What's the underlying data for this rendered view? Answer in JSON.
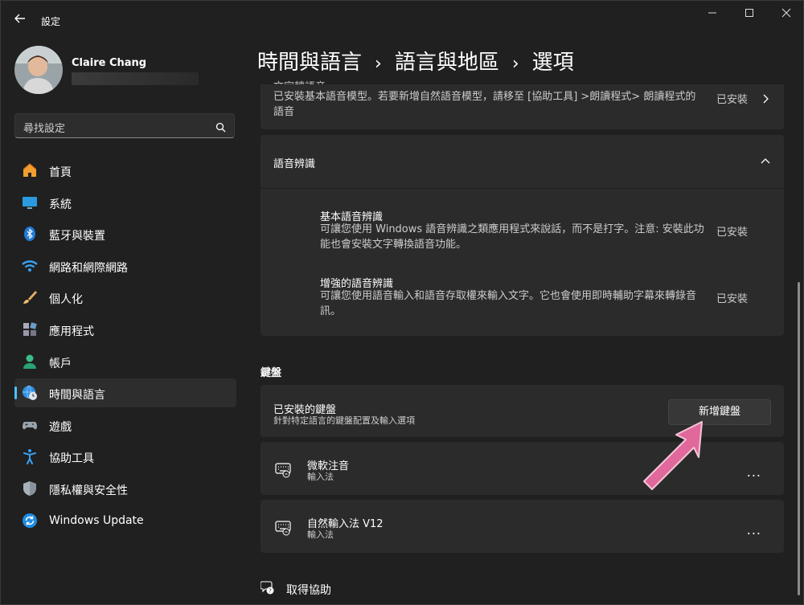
{
  "window": {
    "title": "設定",
    "controls": [
      "minimize",
      "maximize",
      "close"
    ]
  },
  "profile": {
    "name": "Claire Chang"
  },
  "search": {
    "placeholder": "尋找設定"
  },
  "sidebar": {
    "items": [
      {
        "label": "首頁",
        "icon": "home-icon"
      },
      {
        "label": "系統",
        "icon": "system-icon"
      },
      {
        "label": "藍牙與裝置",
        "icon": "bluetooth-icon"
      },
      {
        "label": "網路和網際網路",
        "icon": "wifi-icon"
      },
      {
        "label": "個人化",
        "icon": "brush-icon"
      },
      {
        "label": "應用程式",
        "icon": "apps-icon"
      },
      {
        "label": "帳戶",
        "icon": "account-icon"
      },
      {
        "label": "時間與語言",
        "icon": "time-language-icon",
        "active": true
      },
      {
        "label": "遊戲",
        "icon": "gamepad-icon"
      },
      {
        "label": "協助工具",
        "icon": "accessibility-icon"
      },
      {
        "label": "隱私權與安全性",
        "icon": "shield-icon"
      },
      {
        "label": "Windows Update",
        "icon": "update-icon"
      }
    ]
  },
  "breadcrumb": [
    "時間與語言",
    "語言與地區",
    "選項"
  ],
  "tts": {
    "title_partial": "文字轉語音",
    "desc": "已安裝基本語音模型。若要新增自然語音模型，請移至 [協助工具] >朗讀程式> 朗讀程式的語音",
    "status": "已安裝"
  },
  "speech_recognition": {
    "title": "語音辨識",
    "items": [
      {
        "title": "基本語音辨識",
        "desc": "可讓您使用 Windows 語音辨識之類應用程式來說話，而不是打字。注意: 安裝此功能也會安裝文字轉換語音功能。",
        "status": "已安裝"
      },
      {
        "title": "增強的語音辨識",
        "desc": "可讓您使用語音輸入和語音存取權來輸入文字。它也會使用即時輔助字幕來轉錄音訊。",
        "status": "已安裝"
      }
    ]
  },
  "keyboard": {
    "section_title": "鍵盤",
    "installed_title": "已安裝的鍵盤",
    "installed_desc": "針對特定語言的鍵盤配置及輸入選項",
    "add_button": "新增鍵盤",
    "list": [
      {
        "name": "微軟注音",
        "type": "輸入法",
        "more": "..."
      },
      {
        "name": "自然輸入法 V12",
        "type": "輸入法",
        "more": "..."
      }
    ]
  },
  "help": {
    "label": "取得協助"
  },
  "colors": {
    "accent": "#4cc2ff",
    "annotation_arrow": "#e0689a"
  }
}
